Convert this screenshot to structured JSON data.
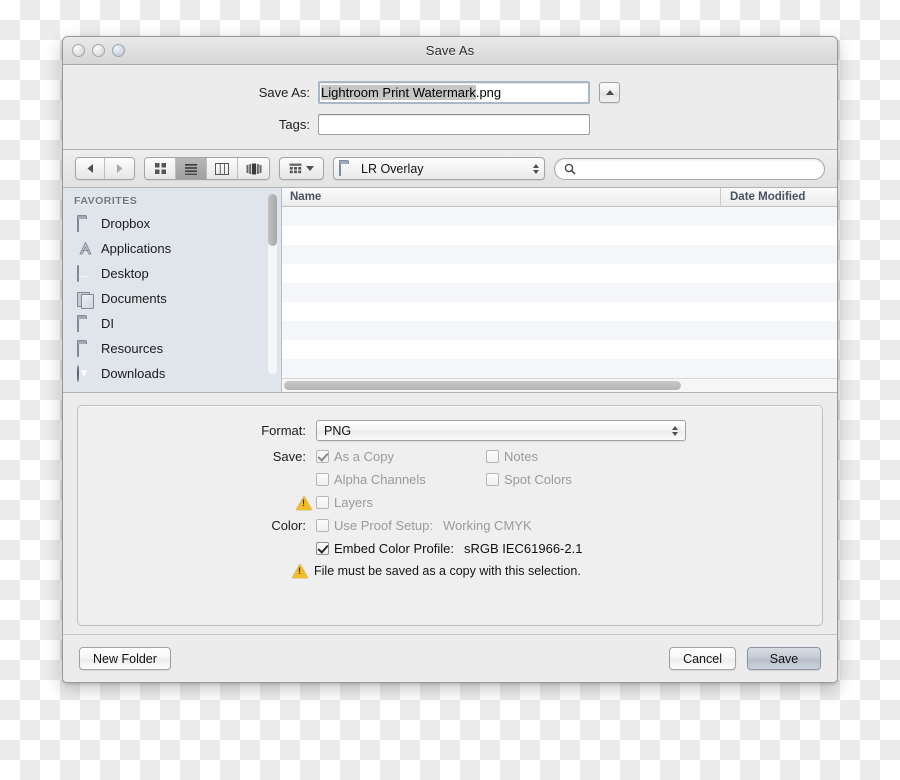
{
  "window": {
    "title": "Save As",
    "traffic_lights": [
      "close-button",
      "minimize-button",
      "zoom-button"
    ]
  },
  "name_area": {
    "save_as_label": "Save As:",
    "filename_selected": "Lightroom Print Watermark",
    "filename_extension": ".png",
    "filename_full": "Lightroom Print Watermark.png",
    "tags_label": "Tags:",
    "tags_value": "",
    "tags_placeholder": "",
    "disclosure_icon": "triangle-up-icon"
  },
  "toolbar": {
    "back_icon": "chevron-left-icon",
    "forward_icon": "chevron-right-icon",
    "views": [
      {
        "name": "icon-view",
        "icon": "grid-icon",
        "selected": false
      },
      {
        "name": "list-view",
        "icon": "list-icon",
        "selected": true
      },
      {
        "name": "column-view",
        "icon": "columns-icon",
        "selected": false
      },
      {
        "name": "coverflow-view",
        "icon": "coverflow-icon",
        "selected": false
      }
    ],
    "action_menu_icon": "action-grid-icon",
    "path_popup": {
      "folder_icon": "folder-icon",
      "value": "LR Overlay"
    },
    "search": {
      "icon": "search-icon",
      "value": "",
      "placeholder": ""
    }
  },
  "sidebar": {
    "header": "FAVORITES",
    "items": [
      {
        "label": "Dropbox",
        "icon": "folder-icon"
      },
      {
        "label": "Applications",
        "icon": "applications-icon"
      },
      {
        "label": "Desktop",
        "icon": "desktop-icon"
      },
      {
        "label": "Documents",
        "icon": "documents-icon"
      },
      {
        "label": "DI",
        "icon": "folder-icon"
      },
      {
        "label": "Resources",
        "icon": "folder-icon"
      },
      {
        "label": "Downloads",
        "icon": "downloads-icon"
      }
    ]
  },
  "filelist": {
    "columns": [
      "Name",
      "Date Modified"
    ],
    "rows": []
  },
  "options": {
    "format_label": "Format:",
    "format_value": "PNG",
    "save_label": "Save:",
    "checkboxes": [
      {
        "label": "As a Copy",
        "checked": true,
        "enabled": false
      },
      {
        "label": "Notes",
        "checked": false,
        "enabled": false
      },
      {
        "label": "Alpha Channels",
        "checked": false,
        "enabled": false
      },
      {
        "label": "Spot Colors",
        "checked": false,
        "enabled": false
      },
      {
        "label": "Layers",
        "checked": false,
        "enabled": false,
        "warning": true
      }
    ],
    "color_label": "Color:",
    "proof_setup_label": "Use Proof Setup:",
    "proof_setup_value": "Working CMYK",
    "embed_profile_label": "Embed Color Profile:",
    "embed_profile_value": "sRGB IEC61966-2.1",
    "warning_message": "File must be saved as a copy with this selection.",
    "warning_icon": "warning-triangle-icon"
  },
  "buttons": {
    "new_folder": "New Folder",
    "cancel": "Cancel",
    "save": "Save"
  },
  "colors": {
    "window_bg": "#ececec",
    "sidebar_bg": "#e0e5eb",
    "warning_yellow": "#f2bd2a",
    "selection_gray": "#c6c6c6",
    "default_button": "#c3c9d2"
  }
}
